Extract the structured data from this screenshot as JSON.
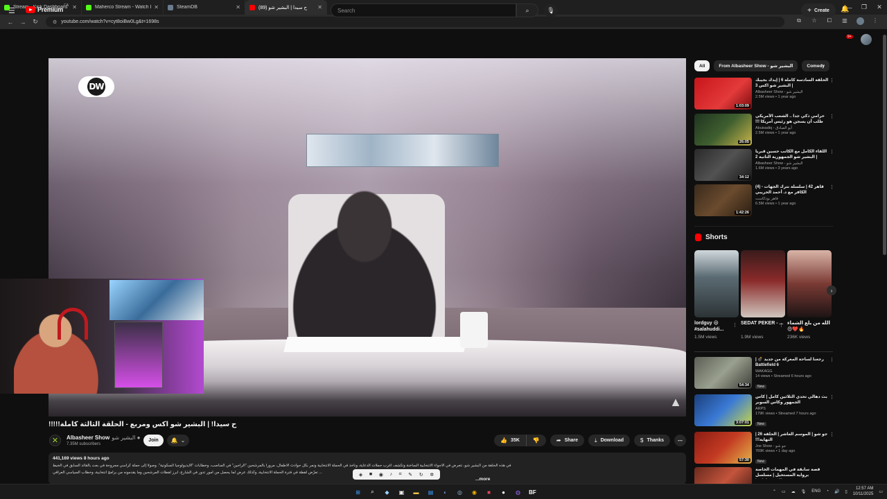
{
  "browser": {
    "tabs": [
      {
        "title": "Stream - Kick Dashboard",
        "favicon_color": "#53fc18"
      },
      {
        "title": "Maherco Stream - Watch Live o",
        "favicon_color": "#53fc18"
      },
      {
        "title": "SteamDB",
        "favicon_color": "#6a7c8f"
      },
      {
        "title": "‫ح سيدا | البشير شو (89)",
        "favicon_color": "#ff0000"
      }
    ],
    "url": "youtube.com/watch?v=cyt8oiBw0Lg&t=1698s"
  },
  "header": {
    "logo_text": "Premium",
    "logo_region": "CA",
    "search_placeholder": "Search",
    "create_label": "Create",
    "notif_count": "9+"
  },
  "video": {
    "watermark": "DW",
    "title": "ح سيدا! | البشير شو اكس ومربع - الحلقة الثالثة كاملة!!!!!",
    "channel_name": "Albasheer Show",
    "channel_name_ar": "البشير شو",
    "subscribers": "7.35M subscribers",
    "join_label": "Join",
    "likes": "35K",
    "share_label": "Share",
    "download_label": "Download",
    "thanks_label": "Thanks",
    "views_date": "441,169 views  8 hours ago",
    "desc_line1": "في هذه الحلقة من البشير شو، نتعرض في الأجواء الانتخابية الساخنة وتكشف أغرب حملات الدعاية، ونأخذ في الحملة الانتخابية ونمر بكل حوادث الأطفال، مروراً بالمرشحين \"الراحين\" في المناصب، وخطابات \"الأيديولوجيا السكوتية\". وصولاً إلى حملة كراسي مجروحة في بعث بالقائد السابق في الخيط",
    "desc_line2": "... تعرّض لقطة في فترة الحملة الانتخابية، وكذلك عرض لما يحصل من أمور تدور في الشارع، أبرز لقطات المرشحين وما يقدمونه من برامج انتخابية، وخطاب السياسي العراقي",
    "more_label": "...more"
  },
  "chips": [
    "All",
    "From Albasheer Show - البشير شو",
    "Comedy"
  ],
  "recommended_top": [
    {
      "title": "الحلقة السادسة كاملة 6 | إيدك بجيبك | البشير شو اكس 3",
      "channel": "Albasheer Show - البشير شو",
      "views": "2.5M views • 1 year ago",
      "duration": "1:03:09",
      "thumb": "linear-gradient(135deg,#c8151b,#e33a3a 60%,#7a0b0e)"
    },
    {
      "title": "حرامي ذكي جدا .. الشعب الأمريكي طلب أن يسجن هو رئيس أمريكا !!!",
      "channel": "Abuisadiq - أبو الصادق",
      "views": "2.5M views • 1 year ago",
      "duration": "26:05",
      "thumb": "linear-gradient(135deg,#1f3320,#3f5f2f 50%,#c8b54a)"
    },
    {
      "title": "اللقاء الكامل مع الكاتب حسين قبرياً | البشير شو الجمهورية الثانية 2",
      "channel": "Albasheer Show - البشير شو",
      "views": "1.6M views • 3 years ago",
      "duration": "34:12",
      "thumb": "linear-gradient(135deg,#2a2a2a,#525252 50%,#1a1a1a)"
    },
    {
      "title": "قاهر 42 | سلسلة نترك الجهات - (4) الكافر مع د. أحمد الحريبي",
      "channel": "قاهر بودكاست",
      "views": "6.5M views • 1 year ago",
      "duration": "1:42:26",
      "thumb": "linear-gradient(135deg,#3a2a1c,#6a4b2e 50%,#2a1d12)"
    }
  ],
  "shorts": {
    "heading": "Shorts",
    "items": [
      {
        "title": "lordguy 😃 #salahuddi...",
        "views": "1.5M views",
        "thumb": "linear-gradient(180deg,#cfd7dc,#5b6b73 40%,#2c3336)"
      },
      {
        "title": "SEDAT PEKER - ...",
        "views": "1.9M views",
        "thumb": "linear-gradient(180deg,#3a1b1b,#8a2a2a 45%,#d0c6be)"
      },
      {
        "title": "الله من بلع الشماء 😍❤️🔥",
        "views": "236K views",
        "thumb": "linear-gradient(180deg,#d9b4a7,#7a3a34 50%,#1d1414)"
      }
    ]
  },
  "recommended_bottom": [
    {
      "title": "رجعنا لساحة المعركة من جديد 💣 | Battlefield 6",
      "channel": "WAKAGG",
      "views": "14 views • Streamed 6 hours ago",
      "duration": "54:34",
      "badge": "New",
      "thumb": "linear-gradient(135deg,#5c5f55,#9aa08f 50%,#3a3c36)"
    },
    {
      "title": "بث دهالي تحدي الثلاثين كامل | كاس الجمهور وكاس السوبر",
      "channel": "ARPS",
      "views": "179K views • Streamed 7 hours ago",
      "duration": "3:07:01",
      "badge": "New",
      "thumb": "linear-gradient(135deg,#1b3f7a,#3a7ad6 50%,#c8d648)"
    },
    {
      "title": "جو شو | الموسم العاشر | الحلقة 26 | النهاية!!!",
      "channel": "Joe Show - جو شو",
      "views": "769K views • 1 day ago",
      "duration": "57:30",
      "badge": "New",
      "thumb": "linear-gradient(135deg,#8a1d14,#c33a22 50%,#e4b44a)"
    },
    {
      "title": "قصة سابقة في المهمات الخاصة برواية المستحيل | مسلسل الاستخبارات |",
      "channel": "",
      "views": "",
      "duration": "",
      "badge": "",
      "thumb": "linear-gradient(135deg,#6a2a1e,#c4543c 50%,#3a1812)"
    }
  ],
  "taskbar": {
    "lang": "ENG",
    "time": "12:57 AM",
    "date": "10/11/2025"
  }
}
